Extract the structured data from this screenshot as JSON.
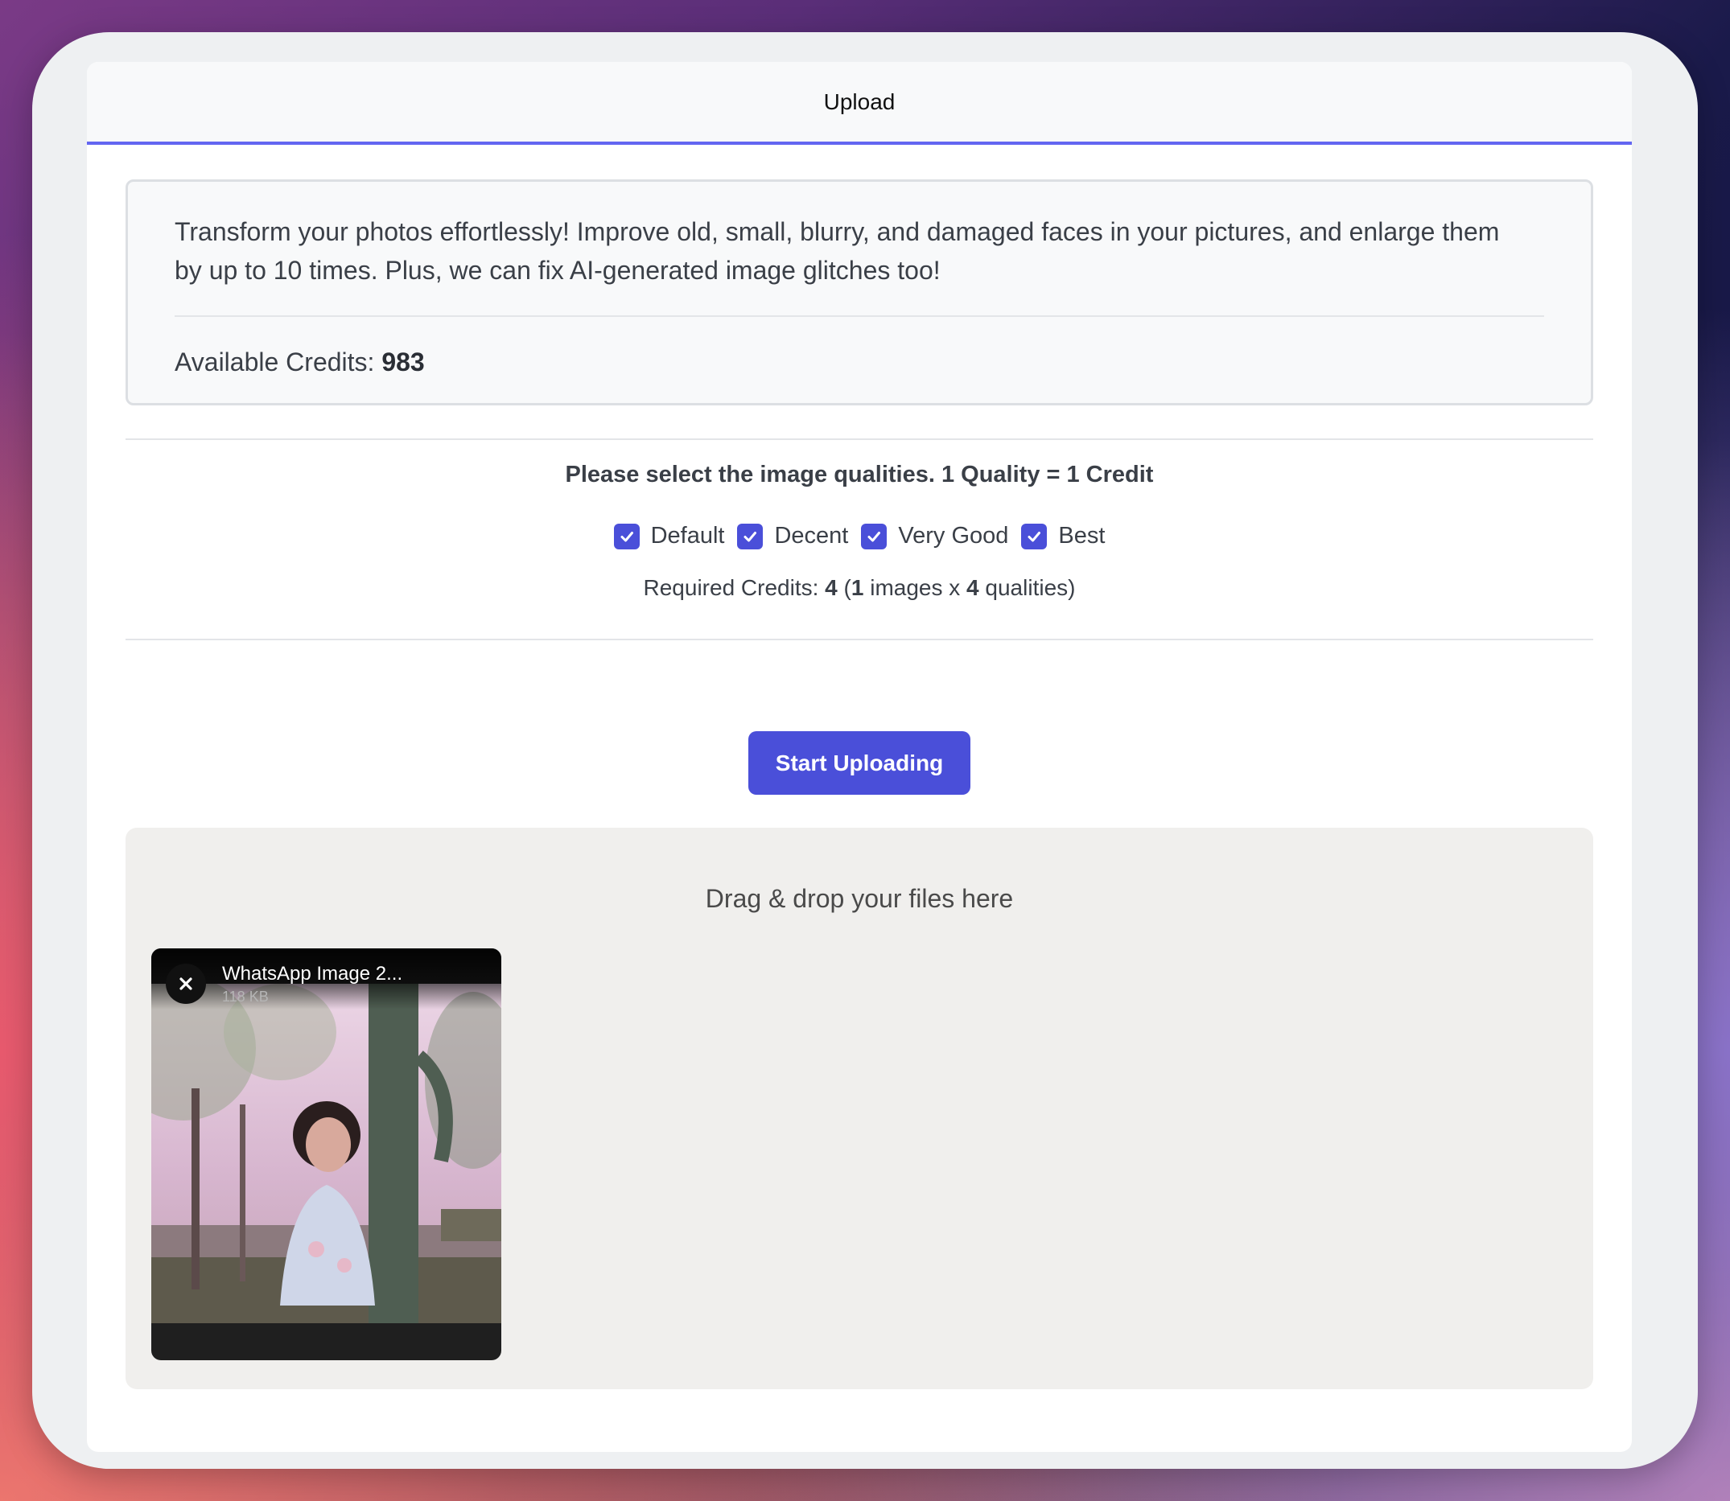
{
  "tab": {
    "label": "Upload"
  },
  "info": {
    "description_line1": "Transform your photos effortlessly! Improve old, small, blurry, and damaged faces in your pictures, and enlarge them",
    "description_line2": "by up to 10 times. Plus, we can fix AI-generated image glitches too!",
    "credits_label": "Available Credits: ",
    "credits_value": "983"
  },
  "quality": {
    "title": "Please select the image qualities. 1 Quality = 1 Credit",
    "options": [
      {
        "label": "Default",
        "checked": true
      },
      {
        "label": "Decent",
        "checked": true
      },
      {
        "label": "Very Good",
        "checked": true
      },
      {
        "label": "Best",
        "checked": true
      }
    ],
    "required_label": "Required Credits: ",
    "required_value": "4",
    "required_open": " (",
    "images_count": "1",
    "images_text": " images x ",
    "qualities_count": "4",
    "qualities_text": " qualities)"
  },
  "actions": {
    "start_label": "Start Uploading"
  },
  "dropzone": {
    "prompt": "Drag & drop your files here",
    "files": [
      {
        "name": "WhatsApp Image 2...",
        "size": "118 KB"
      }
    ]
  },
  "colors": {
    "accent": "#4a4fd9",
    "tab_underline": "#6366f1"
  }
}
